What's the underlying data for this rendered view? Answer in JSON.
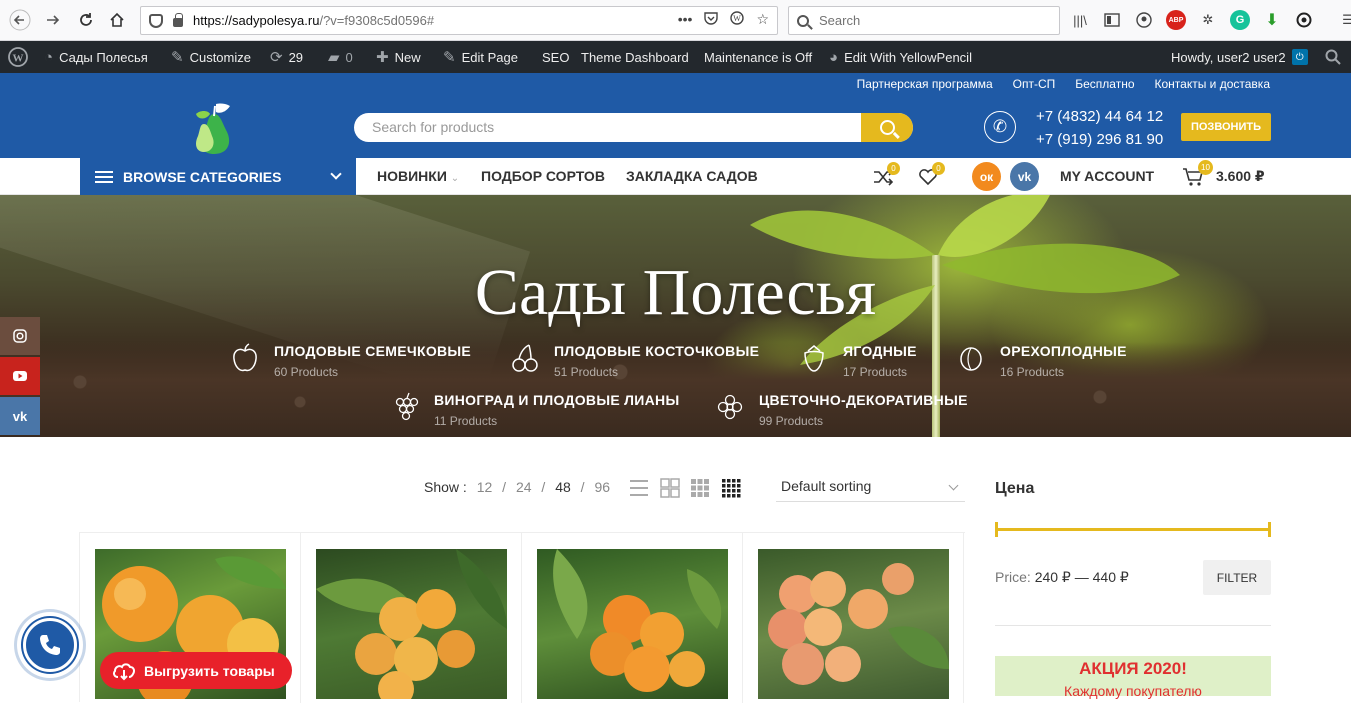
{
  "browser": {
    "url_host": "https://sadypolesya.ru",
    "url_rest": "/?v=f9308c5d0596#",
    "url_actions": "•••",
    "search_placeholder": "Search"
  },
  "wpbar": {
    "site_name": "Сады Полесья",
    "customize": "Customize",
    "updates_count": "29",
    "comments_count": "0",
    "new": "New",
    "edit_page": "Edit Page",
    "seo": "SEO",
    "theme_dashboard": "Theme Dashboard",
    "maintenance": "Maintenance is Off",
    "edit_yellowpencil": "Edit With YellowPencil",
    "howdy": "Howdy, user2 user2"
  },
  "toplinks": [
    "Партнерская программа",
    "Опт-СП",
    "Бесплатно",
    "Контакты и доставка"
  ],
  "header": {
    "search_placeholder": "Search for products",
    "phone1": "+7 (4832) 44 64 12",
    "phone2": "+7 (919) 296 81 90",
    "call_button": "ПОЗВОНИТЬ"
  },
  "nav": {
    "browse": "BROWSE CATEGORIES",
    "items": [
      "НОВИНКИ",
      "ПОДБОР СОРТОВ",
      "ЗАКЛАДКА САДОВ"
    ],
    "compare_count": "0",
    "wishlist_count": "0",
    "ok_label": "ок",
    "vk_label": "vk",
    "my_account": "MY ACCOUNT",
    "cart_count": "10",
    "cart_total": "3.600 ₽"
  },
  "hero": {
    "title": "Сады Полесья",
    "categories": [
      {
        "name": "ПЛОДОВЫЕ СЕМЕЧКОВЫЕ",
        "count": "60 Products",
        "icon": "apple-icon"
      },
      {
        "name": "ПЛОДОВЫЕ КОСТОЧКОВЫЕ",
        "count": "51 Products",
        "icon": "cherry-icon"
      },
      {
        "name": "ЯГОДНЫЕ",
        "count": "17 Products",
        "icon": "strawberry-icon"
      },
      {
        "name": "ОРЕХОПЛОДНЫЕ",
        "count": "16 Products",
        "icon": "nut-icon"
      },
      {
        "name": "ВИНОГРАД И ПЛОДОВЫЕ ЛИАНЫ",
        "count": "11 Products",
        "icon": "grape-icon"
      },
      {
        "name": "ЦВЕТОЧНО-ДЕКОРАТИВНЫЕ",
        "count": "99 Products",
        "icon": "flower-icon"
      }
    ]
  },
  "side_social": [
    "instagram",
    "youtube",
    "vk"
  ],
  "toolbar": {
    "show_label": "Show :",
    "per_page": [
      "12",
      "24",
      "48",
      "96"
    ],
    "per_page_active": "48",
    "sorting": "Default sorting"
  },
  "sidebar": {
    "price_title": "Цена",
    "price_label": "Price:",
    "price_range": "240 ₽ — 440 ₽",
    "filter": "FILTER",
    "promo_title": "АКЦИЯ 2020!",
    "promo_sub": "Каждому покупателю"
  },
  "products": [
    "apricot-photo-1",
    "apricot-photo-2",
    "apricot-photo-3",
    "apricot-photo-4"
  ],
  "export_button": "Выгрузить товары",
  "colors": {
    "brand_blue": "#1f5aa6",
    "accent_yellow": "#e5b91e",
    "wp_dark": "#23282d",
    "export_red": "#e8212a"
  }
}
